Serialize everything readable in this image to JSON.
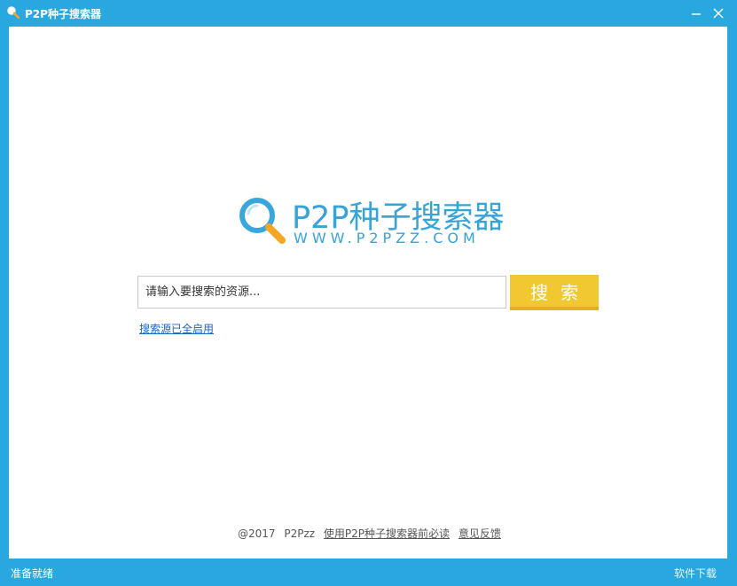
{
  "window": {
    "title": "P2P种子搜索器",
    "accent_color": "#29a8e0",
    "controls": [
      "minimize-icon",
      "close-icon"
    ]
  },
  "logo": {
    "name": "P2P种子搜索器",
    "url": "WWW.P2PZZ.COM",
    "icon": "magnifier-icon"
  },
  "search": {
    "placeholder": "请输入要搜索的资源...",
    "value": "",
    "button_label": "搜索",
    "button_color": "#f1c832"
  },
  "sources_link": "搜索源已全启用",
  "footer": {
    "copyright": "@2017",
    "brand": "P2Pzz",
    "readme_link": "使用P2P种子搜索器前必读",
    "feedback_link": "意见反馈"
  },
  "statusbar": {
    "status": "准备就绪",
    "right_link": "软件下载"
  }
}
